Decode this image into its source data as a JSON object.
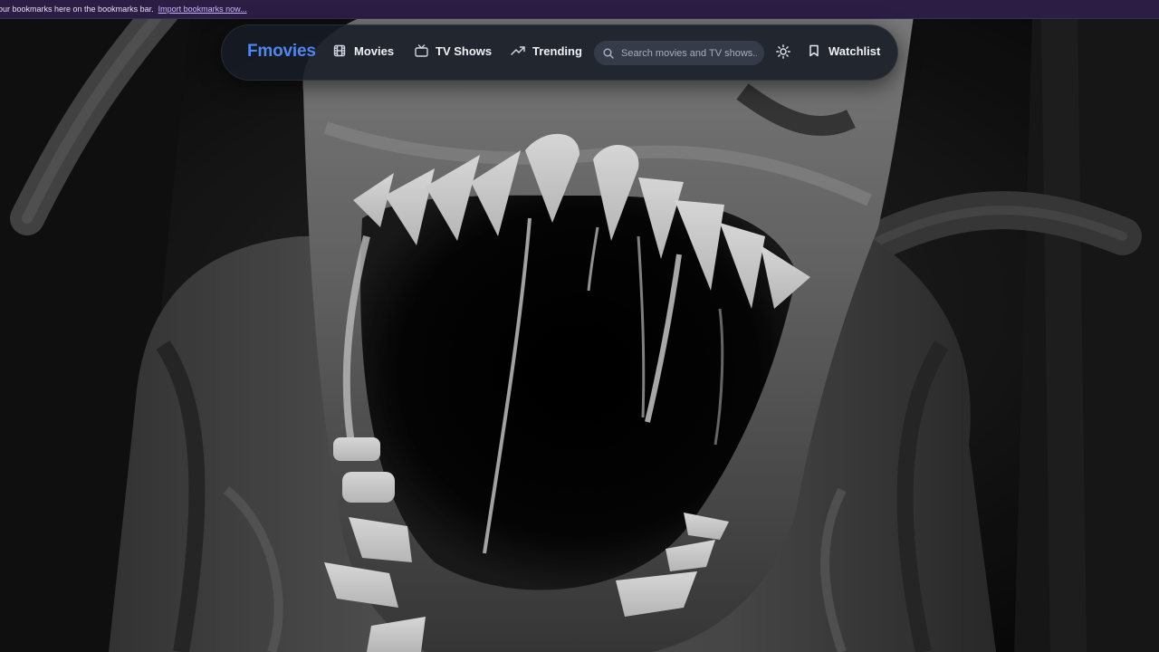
{
  "bookmarks_bar": {
    "message": "our bookmarks here on the bookmarks bar.",
    "import_link": "Import bookmarks now..."
  },
  "navbar": {
    "brand": "Fmovies",
    "brand_color": "#4f86f0",
    "items": [
      {
        "label": "Movies",
        "icon": "film-icon"
      },
      {
        "label": "TV Shows",
        "icon": "tv-icon"
      },
      {
        "label": "Trending",
        "icon": "trending-up-icon"
      }
    ],
    "search": {
      "placeholder": "Search movies and TV shows...",
      "value": "",
      "icon": "search-icon"
    },
    "theme_toggle_icon": "sun-icon",
    "watchlist": {
      "label": "Watchlist",
      "icon": "bookmark-icon"
    }
  },
  "hero": {
    "image": "grayscale close-up of a creature with gaping toothed mouth"
  }
}
